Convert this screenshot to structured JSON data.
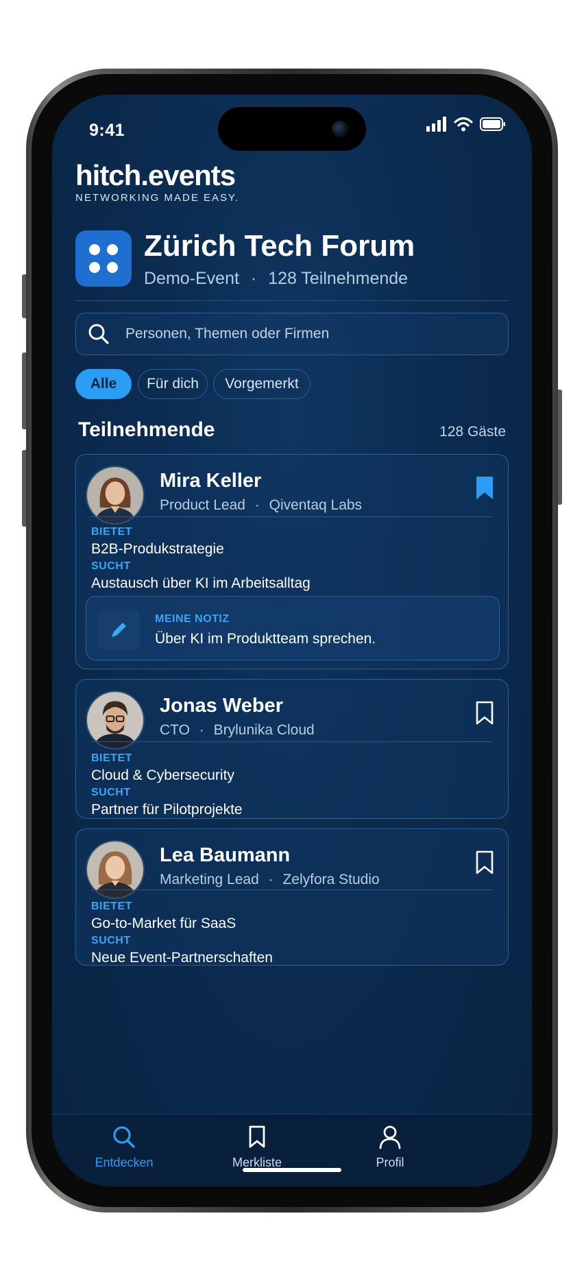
{
  "status_bar": {
    "time": "9:41"
  },
  "brand": {
    "logo": "hitch.events",
    "tagline": "NETWORKING MADE EASY."
  },
  "event": {
    "title": "Zürich Tech Forum",
    "type": "Demo-Event",
    "separator": "·",
    "participants": "128 Teilnehmende"
  },
  "search": {
    "placeholder": "Personen, Themen oder Firmen"
  },
  "filters": [
    {
      "label": "Alle",
      "active": true
    },
    {
      "label": "Für dich",
      "active": false
    },
    {
      "label": "Vorgemerkt",
      "active": false
    }
  ],
  "section": {
    "title": "Teilnehmende",
    "count": "128 Gäste"
  },
  "labels": {
    "offers": "BIETET",
    "seeks": "SUCHT",
    "note": "MEINE NOTIZ"
  },
  "attendees": [
    {
      "name": "Mira Keller",
      "role": "Product Lead",
      "company": "Qiventaq Labs",
      "bookmarked": true,
      "offers": "B2B-Produkstrategie",
      "seeks": "Austausch über KI im Arbeitsalltag",
      "note": "Über KI im Produktteam sprechen."
    },
    {
      "name": "Jonas Weber",
      "role": "CTO",
      "company": "Brylunika Cloud",
      "bookmarked": false,
      "offers": "Cloud & Cybersecurity",
      "seeks": "Partner für Pilotprojekte"
    },
    {
      "name": "Lea Baumann",
      "role": "Marketing Lead",
      "company": "Zelyfora Studio",
      "bookmarked": false,
      "offers": "Go-to-Market für SaaS",
      "seeks": "Neue Event-Partnerschaften"
    }
  ],
  "tabbar": [
    {
      "label": "Entdecken",
      "icon": "search-icon",
      "active": true
    },
    {
      "label": "Merkliste",
      "icon": "bookmark-icon",
      "active": false
    },
    {
      "label": "Profil",
      "icon": "user-icon",
      "active": false
    }
  ],
  "colors": {
    "background": "#0b2b50",
    "accent": "#2a9df4",
    "label_accent": "#3aa6f5",
    "border": "#2f5f93"
  }
}
